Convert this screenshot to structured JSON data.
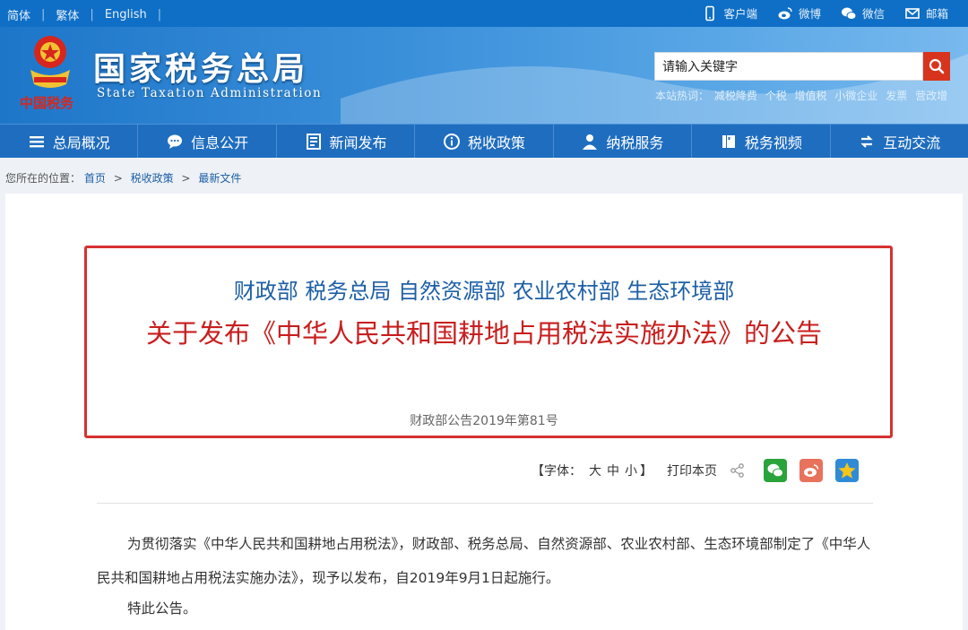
{
  "topbar": {
    "langs": [
      "简体",
      "繁体",
      "English"
    ],
    "quick": [
      {
        "label": "客户端",
        "icon": "mobile-icon"
      },
      {
        "label": "微博",
        "icon": "weibo-icon"
      },
      {
        "label": "微信",
        "icon": "wechat-icon"
      },
      {
        "label": "邮箱",
        "icon": "mail-icon"
      }
    ]
  },
  "header": {
    "title_cn": "国家税务总局",
    "title_en": "State Taxation Administration",
    "emblem_text": "中国税务",
    "search_placeholder": "请输入关键字",
    "hot_label": "本站热词：",
    "hot_words": [
      "减税降费",
      "个税",
      "增值税",
      "小微企业",
      "发票",
      "营改增"
    ]
  },
  "nav": [
    {
      "label": "总局概况",
      "icon": "menu-icon"
    },
    {
      "label": "信息公开",
      "icon": "chat-bubble-icon"
    },
    {
      "label": "新闻发布",
      "icon": "news-icon"
    },
    {
      "label": "税收政策",
      "icon": "info-icon"
    },
    {
      "label": "纳税服务",
      "icon": "person-icon"
    },
    {
      "label": "税务视频",
      "icon": "video-icon"
    },
    {
      "label": "互动交流",
      "icon": "exchange-icon"
    }
  ],
  "breadcrumb": {
    "prefix": "您所在的位置：",
    "items": [
      "首页",
      "税收政策",
      "最新文件"
    ],
    "separator": ">"
  },
  "article": {
    "issuers": "财政部 税务总局 自然资源部 农业农村部 生态环境部",
    "title": "关于发布《中华人民共和国耕地占用税法实施办法》的公告",
    "doc_number": "财政部公告2019年第81号",
    "font_label": "【字体：",
    "font_sizes": [
      "大",
      "中",
      "小"
    ],
    "font_close": "】",
    "print_label": "打印本页",
    "paragraphs": [
      "为贯彻落实《中华人民共和国耕地占用税法》，财政部、税务总局、自然资源部、农业农村部、生态环境部制定了《中华人民共和国耕地占用税法实施办法》，现予以发布，自2019年9月1日起施行。",
      "特此公告。"
    ]
  },
  "colors": {
    "topbar": "#0f6fc6",
    "nav": "#1f6dbf",
    "issuer_blue": "#1d5fa6",
    "title_red": "#c81e1e",
    "highlight_border": "#d63131",
    "search_button": "#d8341d"
  }
}
